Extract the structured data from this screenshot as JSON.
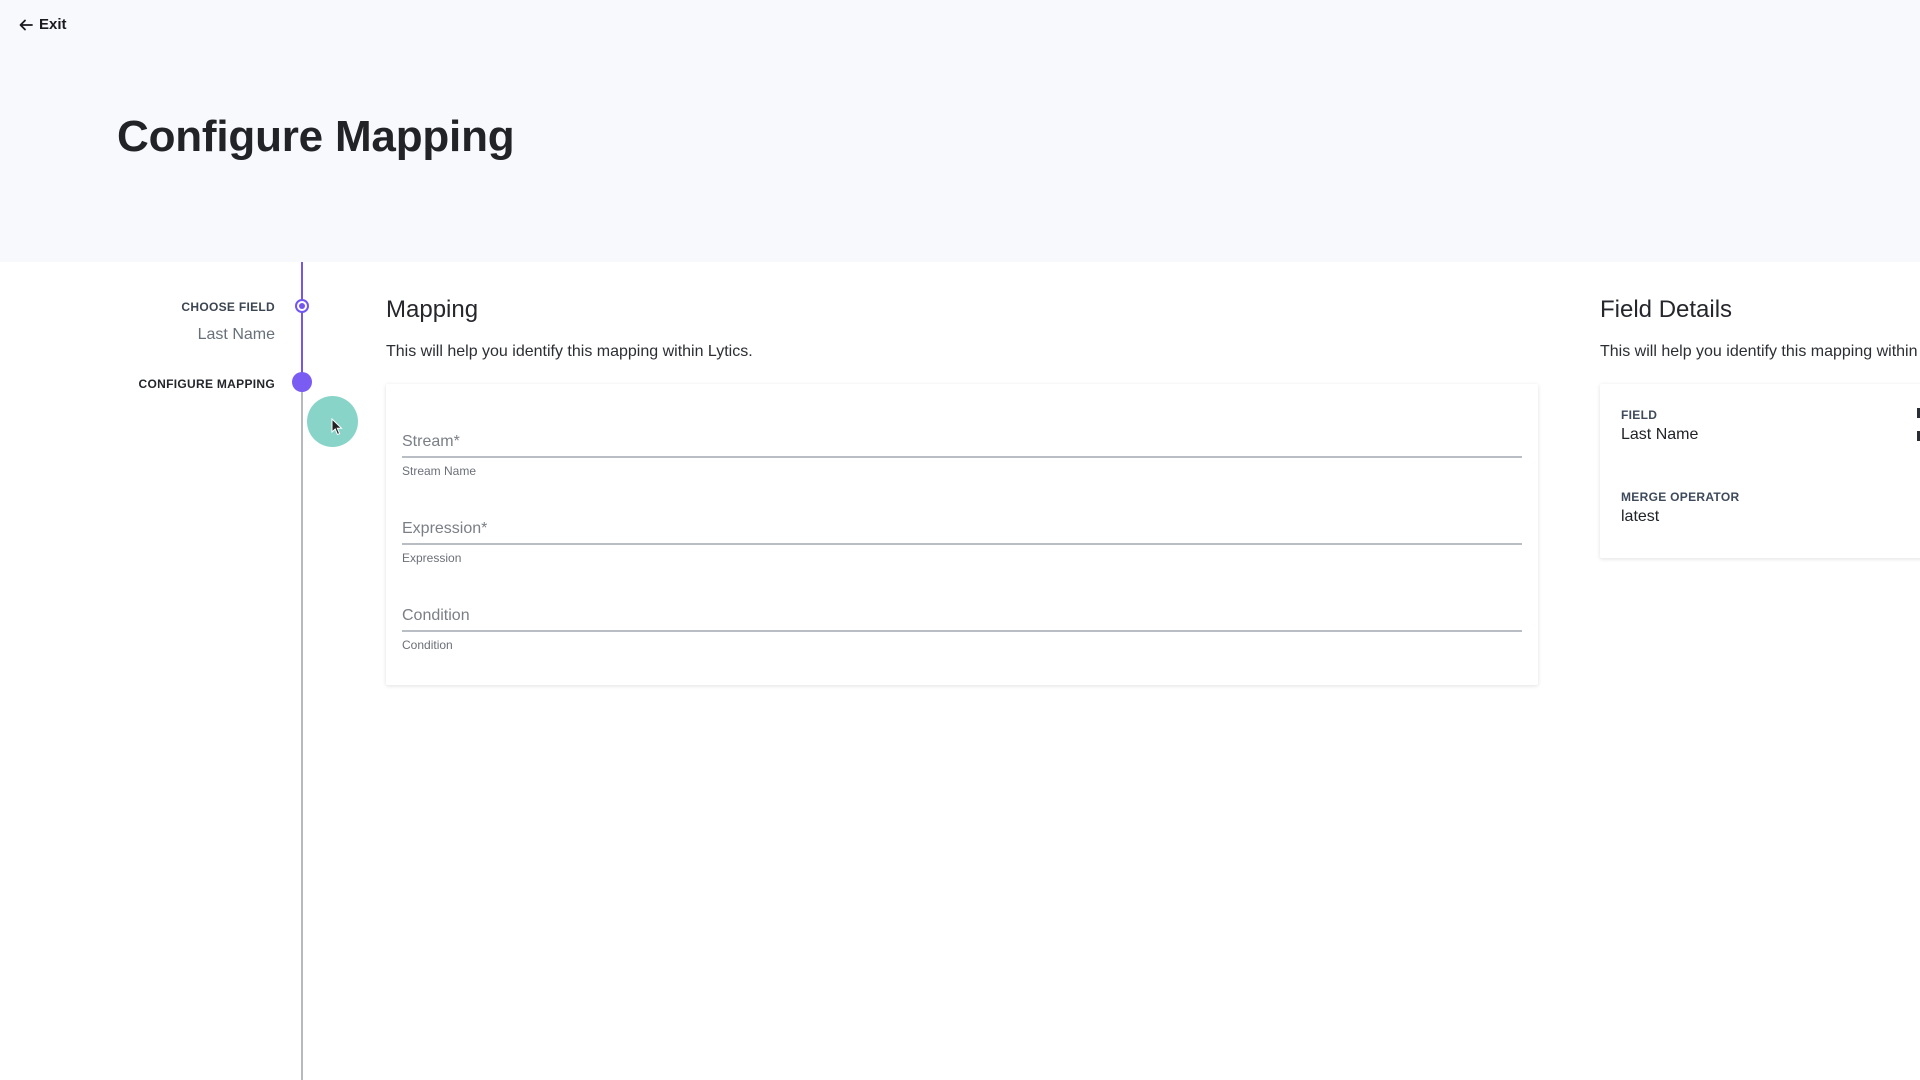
{
  "header": {
    "exit_label": "Exit",
    "title": "Configure Mapping"
  },
  "stepper": {
    "steps": [
      {
        "label": "CHOOSE FIELD",
        "value": "Last Name",
        "state": "completed"
      },
      {
        "label": "CONFIGURE MAPPING",
        "state": "active"
      }
    ],
    "accent_color": "#7356f0"
  },
  "mapping": {
    "title": "Mapping",
    "description": "This will help you identify this mapping within Lytics.",
    "fields": [
      {
        "placeholder": "Stream*",
        "value": "",
        "helper": "Stream Name"
      },
      {
        "placeholder": "Expression*",
        "value": "",
        "helper": "Expression"
      },
      {
        "placeholder": "Condition",
        "value": "",
        "helper": "Condition"
      }
    ]
  },
  "field_details": {
    "title": "Field Details",
    "description": "This will help you identify this mapping within",
    "items": [
      {
        "label": "FIELD",
        "value": "Last Name"
      },
      {
        "label": "MERGE OPERATOR",
        "value": "latest"
      }
    ]
  }
}
